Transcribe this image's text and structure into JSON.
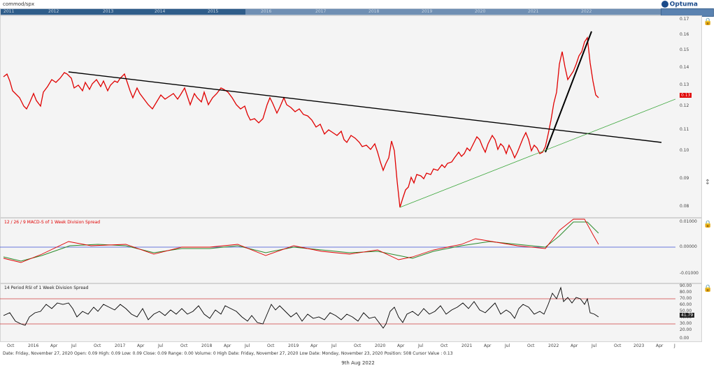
{
  "title": "commod/spx",
  "logo": "Optuma",
  "navigator_years": [
    "2011",
    "2012",
    "2013",
    "2014",
    "2015",
    "2016",
    "2017",
    "2018",
    "2019",
    "2020",
    "2021",
    "2022"
  ],
  "main_axis": [
    "0.17",
    "0.16",
    "0.15",
    "0.14",
    "0.13",
    "0.12",
    "0.11",
    "0.10",
    "0.09",
    "0.08"
  ],
  "main_price_tag": "0.13",
  "macd_title": "12 / 26 / 9 MACD-S of 1 Week Division Spread",
  "macd_axis": [
    "0.01000",
    "0.00000",
    "-0.01000"
  ],
  "rsi_title": "14 Period RSI of 1 Week Division Spread",
  "rsi_axis": [
    "90.00",
    "80.00",
    "70.00",
    "60.00",
    "50.00",
    "40.00",
    "30.00",
    "20.00",
    "0.00"
  ],
  "rsi_tag": "41.79",
  "x_axis": [
    "Oct",
    "2016",
    "Apr",
    "Jul",
    "Oct",
    "2017",
    "Apr",
    "Jul",
    "Oct",
    "2018",
    "Apr",
    "Jul",
    "Oct",
    "2019",
    "Apr",
    "Jul",
    "Oct",
    "2020",
    "Apr",
    "Jul",
    "Oct",
    "2021",
    "Apr",
    "Jul",
    "Oct",
    "2022",
    "Apr",
    "Jul",
    "Oct",
    "2023",
    "Apr",
    "J"
  ],
  "status": "Date: Friday, November 27, 2020 Open: 0.09 High: 0.09 Low: 0.09 Close: 0.09 Range: 0.00 Volume: 0 High Date: Friday, November 27, 2020 Low Date: Monday, November 23, 2020 Position: 508 Cursor Value : 0.13",
  "footer_date": "9th Aug 2022",
  "colors": {
    "price": "#e00000",
    "trend": "#000000",
    "support": "#3aa63a",
    "macd_signal": "#2a8a2a",
    "zero": "#3b4fd6",
    "rsi_band": "#d04040"
  }
}
